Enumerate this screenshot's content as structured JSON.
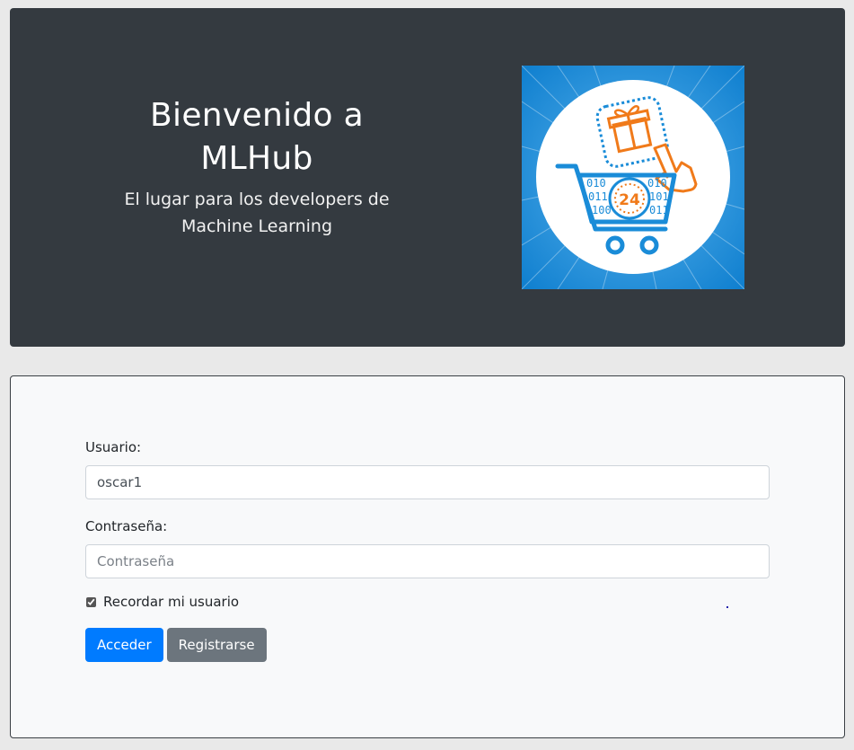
{
  "hero": {
    "title": "Bienvenido a MLHub",
    "subtitle": "El lugar para los developers de Machine Learning",
    "logo_icon": "shopping-cart-24h-icon",
    "logo_text": "24",
    "colors": {
      "background": "#343a40",
      "logo_blue": "#1a8cd8",
      "logo_orange": "#f07a1a"
    }
  },
  "login": {
    "username_label": "Usuario:",
    "username_value": "oscar1",
    "password_label": "Contraseña:",
    "password_placeholder": "Contraseña",
    "remember_label": "Recordar mi usuario",
    "remember_checked": true,
    "login_button": "Acceder",
    "register_button": "Registrarse",
    "colors": {
      "primary": "#007bff",
      "secondary": "#6c757d"
    }
  }
}
